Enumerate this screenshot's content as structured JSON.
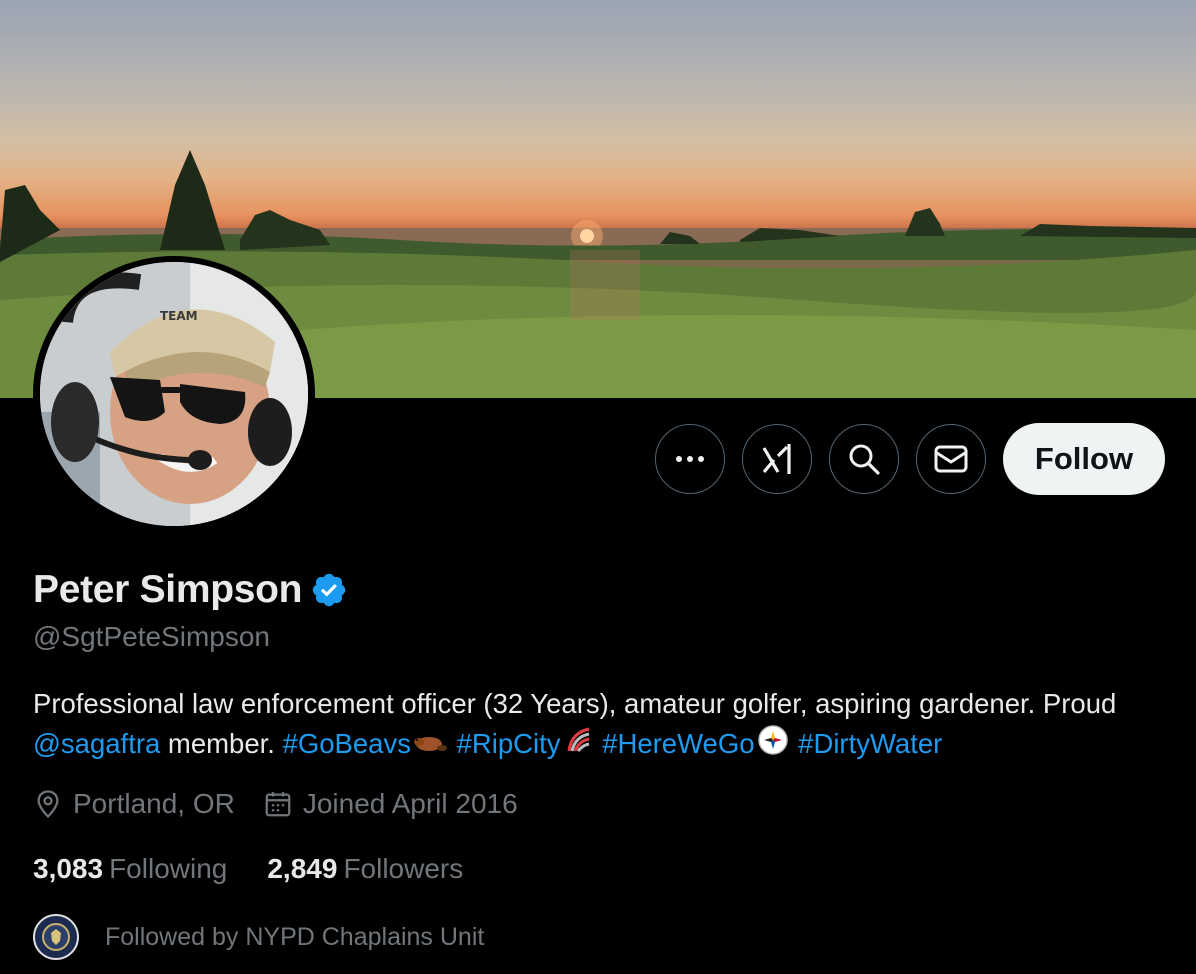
{
  "profile": {
    "display_name": "Peter Simpson",
    "handle": "@SgtPeteSimpson",
    "verified_icon": "verified-badge-icon",
    "bio": {
      "text_1": "Professional law enforcement officer (32 Years), amateur golfer, aspiring gardener. Proud ",
      "mention": "@sagaftra",
      "text_2": " member. ",
      "hashtag_1": "#GoBeavs",
      "hashtag_2": "#RipCity",
      "hashtag_3": "#HereWeGo",
      "hashtag_4": "#DirtyWater"
    },
    "location": "Portland, OR",
    "joined": "Joined April 2016",
    "following_count": "3,083",
    "following_label": "Following",
    "followers_count": "2,849",
    "followers_label": "Followers",
    "followed_by": "Followed by NYPD Chaplains Unit"
  },
  "actions": {
    "more_icon": "more-icon",
    "grok_icon": "grok-icon",
    "search_icon": "search-icon",
    "message_icon": "message-icon",
    "follow_label": "Follow"
  },
  "colors": {
    "background": "#000000",
    "text_primary": "#e7e9ea",
    "text_secondary": "#71767b",
    "link": "#1d9bf0",
    "follow_button_bg": "#eff3f4"
  }
}
